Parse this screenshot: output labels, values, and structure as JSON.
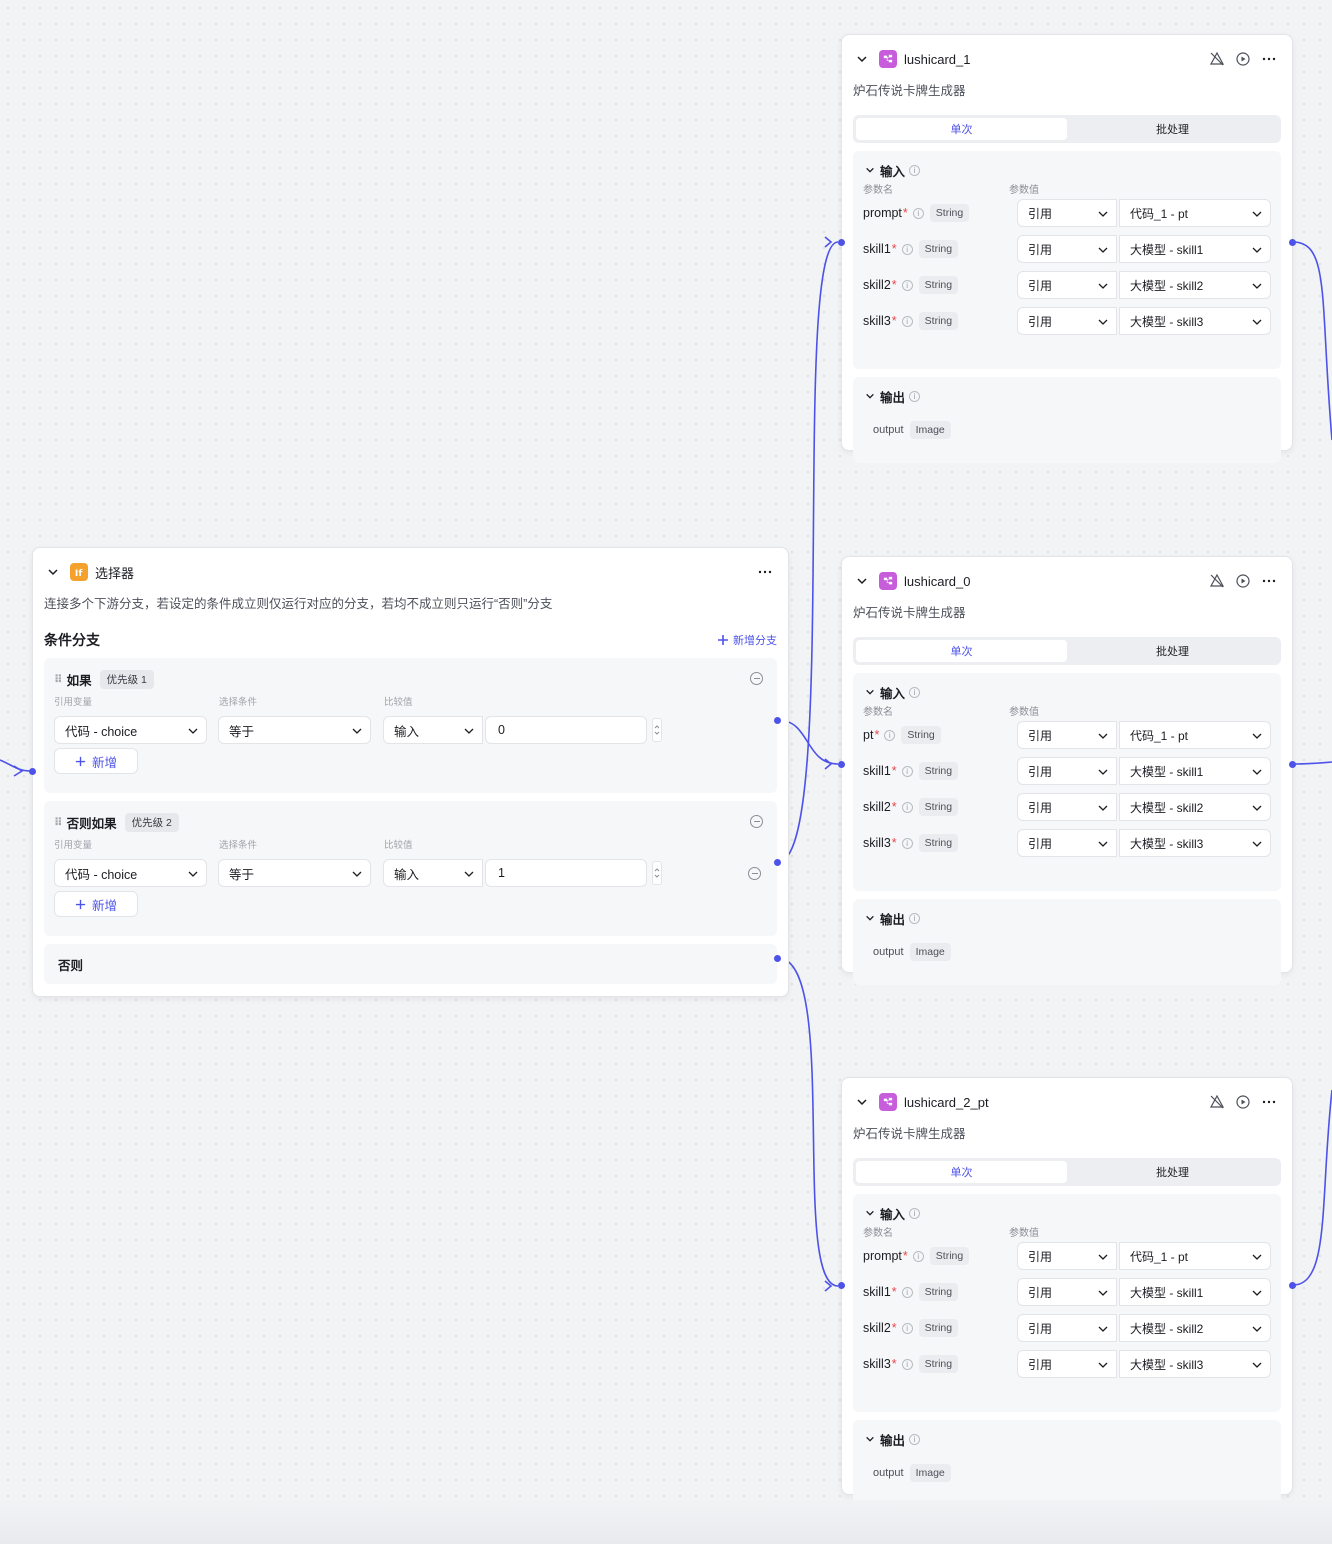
{
  "selector": {
    "title": "选择器",
    "description": "连接多个下游分支，若设定的条件成立则仅运行对应的分支，若均不成立则只运行“否则”分支",
    "section_title": "条件分支",
    "add_branch_label": "新增分支",
    "col_var": "引用变量",
    "col_cond": "选择条件",
    "col_cmp": "比较值",
    "branches": [
      {
        "label": "如果",
        "priority": "优先级 1",
        "var": "代码 - choice",
        "cond": "等于",
        "cmp_type": "输入",
        "cmp_value": "0",
        "add_label": "新增"
      },
      {
        "label": "否则如果",
        "priority": "优先级 2",
        "var": "代码 - choice",
        "cond": "等于",
        "cmp_type": "输入",
        "cmp_value": "1",
        "add_label": "新增"
      }
    ],
    "else_label": "否则"
  },
  "plugin_nodes": [
    {
      "title": "lushicard_1",
      "subtitle": "炉石传说卡牌生成器",
      "tab_single": "单次",
      "tab_batch": "批处理",
      "input_label": "输入",
      "col_name": "参数名",
      "col_value": "参数值",
      "params": [
        {
          "name": "prompt",
          "type": "String",
          "mode": "引用",
          "ref": "代码_1 - pt"
        },
        {
          "name": "skill1",
          "type": "String",
          "mode": "引用",
          "ref": "大模型 - skill1"
        },
        {
          "name": "skill2",
          "type": "String",
          "mode": "引用",
          "ref": "大模型 - skill2"
        },
        {
          "name": "skill3",
          "type": "String",
          "mode": "引用",
          "ref": "大模型 - skill3"
        }
      ],
      "output_label": "输出",
      "output_name": "output",
      "output_type": "Image"
    },
    {
      "title": "lushicard_0",
      "subtitle": "炉石传说卡牌生成器",
      "tab_single": "单次",
      "tab_batch": "批处理",
      "input_label": "输入",
      "col_name": "参数名",
      "col_value": "参数值",
      "params": [
        {
          "name": "pt",
          "type": "String",
          "mode": "引用",
          "ref": "代码_1 - pt"
        },
        {
          "name": "skill1",
          "type": "String",
          "mode": "引用",
          "ref": "大模型 - skill1"
        },
        {
          "name": "skill2",
          "type": "String",
          "mode": "引用",
          "ref": "大模型 - skill2"
        },
        {
          "name": "skill3",
          "type": "String",
          "mode": "引用",
          "ref": "大模型 - skill3"
        }
      ],
      "output_label": "输出",
      "output_name": "output",
      "output_type": "Image"
    },
    {
      "title": "lushicard_2_pt",
      "subtitle": "炉石传说卡牌生成器",
      "tab_single": "单次",
      "tab_batch": "批处理",
      "input_label": "输入",
      "col_name": "参数名",
      "col_value": "参数值",
      "params": [
        {
          "name": "prompt",
          "type": "String",
          "mode": "引用",
          "ref": "代码_1 - pt"
        },
        {
          "name": "skill1",
          "type": "String",
          "mode": "引用",
          "ref": "大模型 - skill1"
        },
        {
          "name": "skill2",
          "type": "String",
          "mode": "引用",
          "ref": "大模型 - skill2"
        },
        {
          "name": "skill3",
          "type": "String",
          "mode": "引用",
          "ref": "大模型 - skill3"
        }
      ],
      "output_label": "输出",
      "output_name": "output",
      "output_type": "Image"
    }
  ],
  "colors": {
    "accent": "#4d53e8",
    "plugin_icon": "#c75ddb",
    "selector_icon": "#f5a12d",
    "required": "#e5484d"
  },
  "icons": {
    "collapse": "chevron-down-icon",
    "plugin": "plugin-icon",
    "selector": "if-icon",
    "error": "error-off-icon",
    "run": "play-icon",
    "more": "more-icon"
  }
}
